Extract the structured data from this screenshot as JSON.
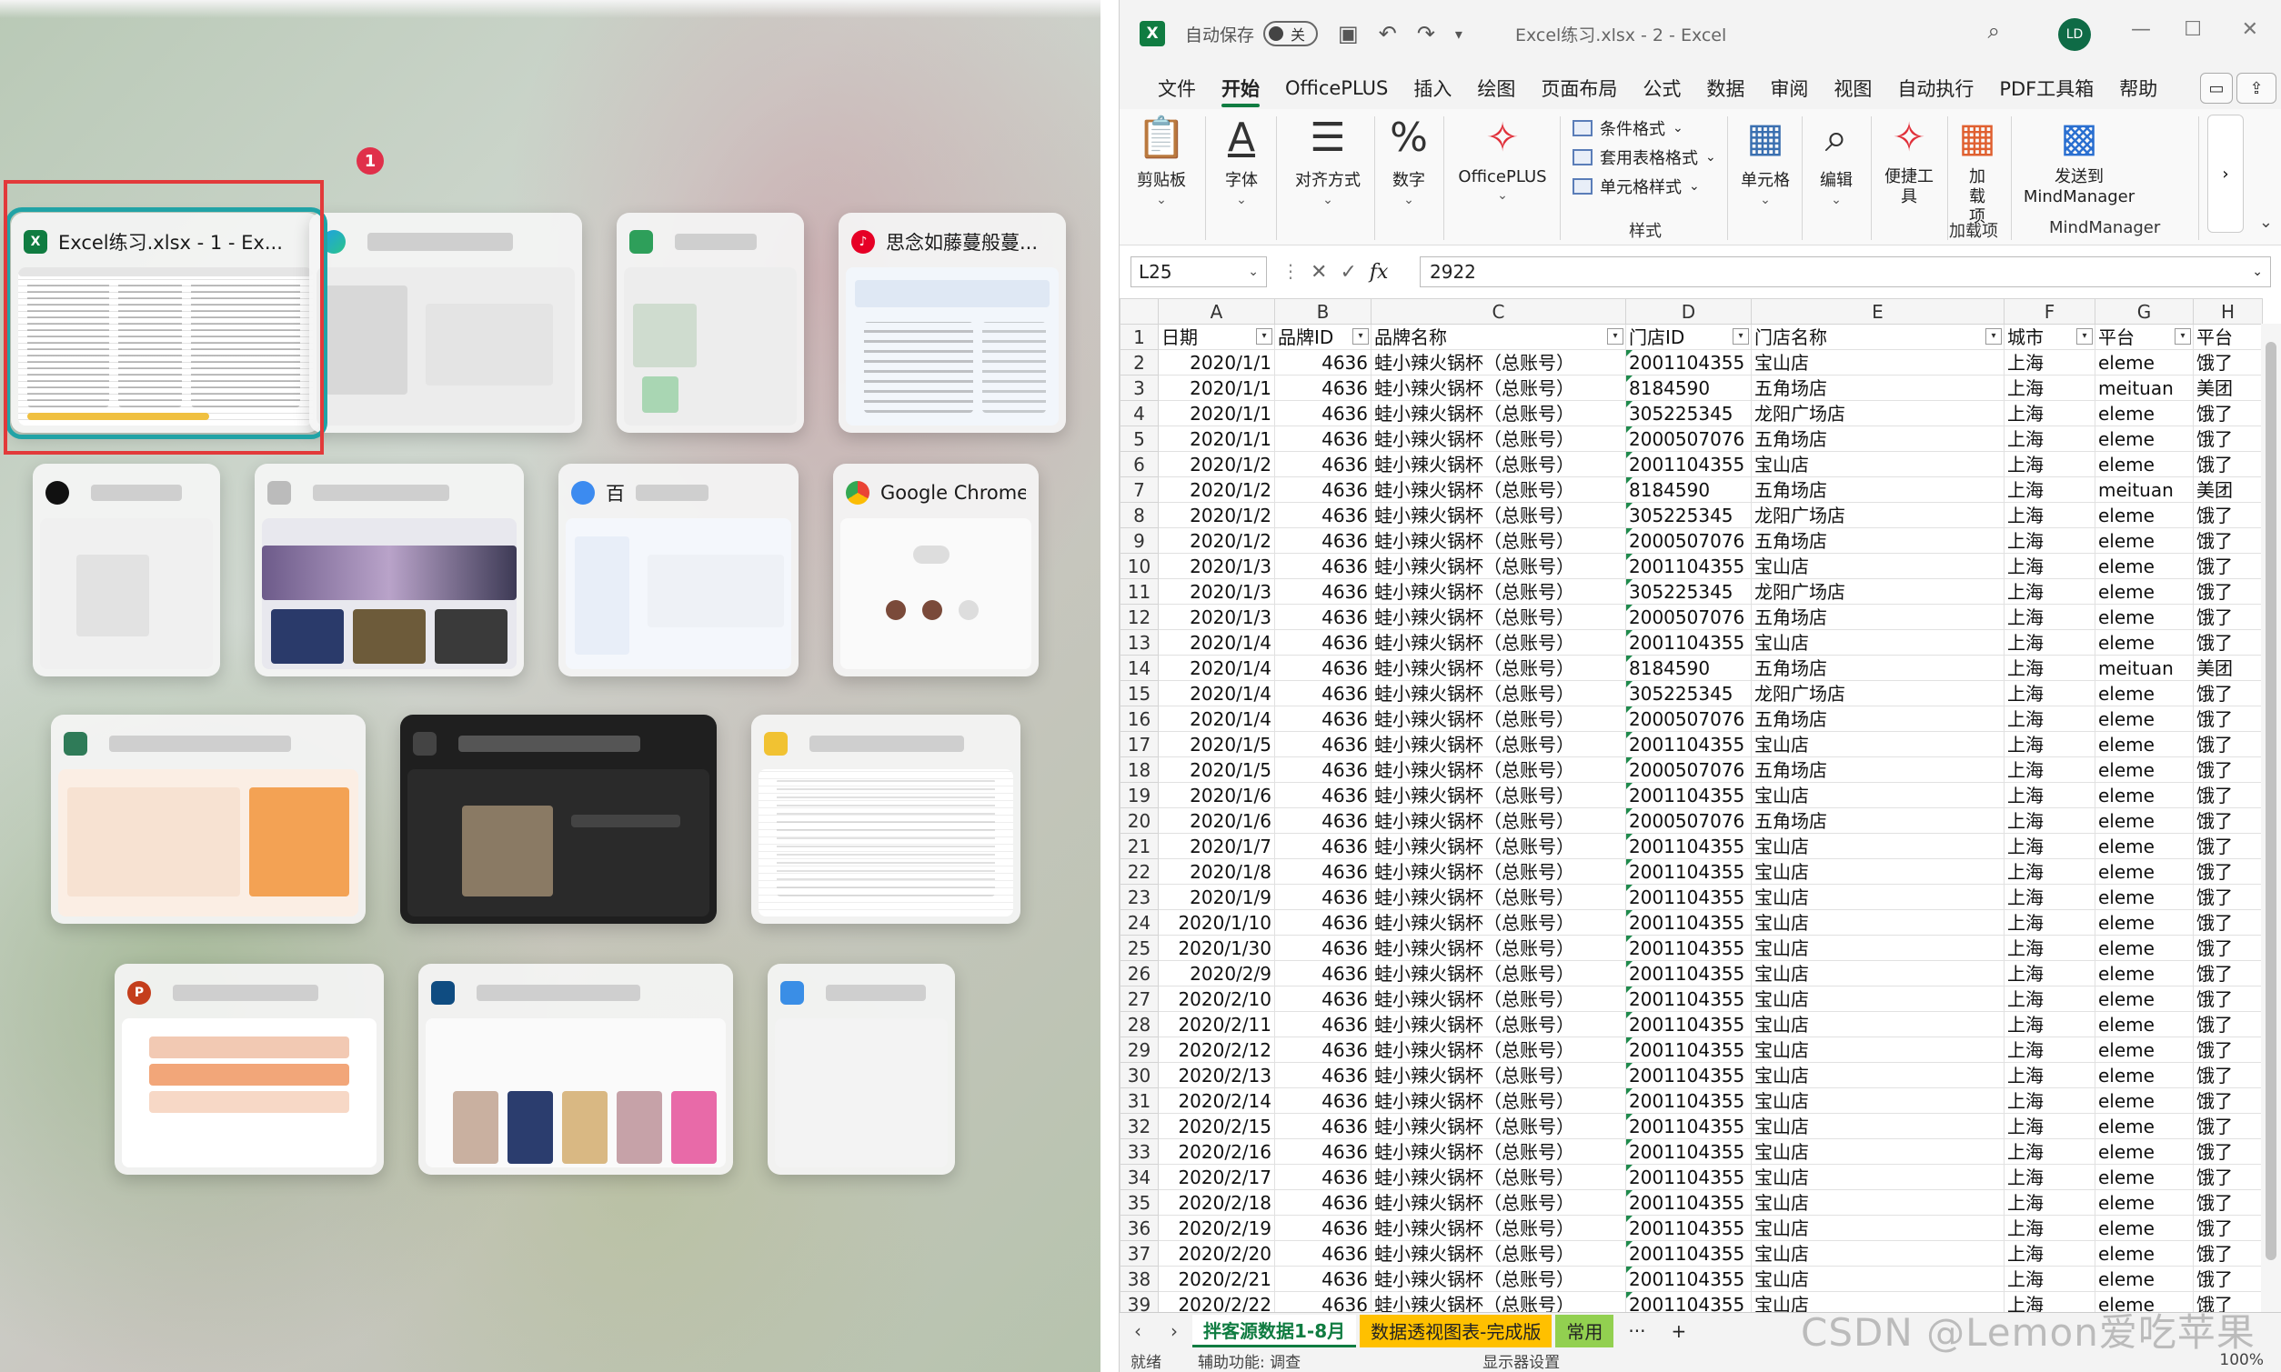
{
  "switcher": {
    "badge_count": "1",
    "windows": [
      {
        "title": "Excel练习.xlsx  -  1 - Ex...",
        "icon": "excel-icon"
      },
      {
        "title": "",
        "icon": "edge-icon"
      },
      {
        "title": "",
        "icon": "app-icon"
      },
      {
        "title": "思念如藤蔓般蔓...",
        "icon": "netease-music-icon"
      },
      {
        "title": "",
        "icon": "qq-icon"
      },
      {
        "title": "",
        "icon": "app-icon"
      },
      {
        "title": "百",
        "icon": "baidu-netdisk-icon"
      },
      {
        "title": "Google Chrome",
        "icon": "chrome-icon"
      },
      {
        "title": "",
        "icon": "app-icon"
      },
      {
        "title": "",
        "icon": "app-icon"
      },
      {
        "title": "",
        "icon": "app-icon"
      },
      {
        "title": "",
        "icon": "powerpoint-icon"
      },
      {
        "title": "",
        "icon": "app-icon"
      },
      {
        "title": "",
        "icon": "app-icon"
      }
    ]
  },
  "excel": {
    "autosave_label": "自动保存",
    "autosave_state": "关",
    "doc_title": "Excel练习.xlsx  -  2  -  Excel",
    "user_initials": "LD",
    "menu": [
      "文件",
      "开始",
      "OfficePLUS",
      "插入",
      "绘图",
      "页面布局",
      "公式",
      "数据",
      "审阅",
      "视图",
      "自动执行",
      "PDF工具箱",
      "帮助"
    ],
    "active_menu": "开始",
    "ribbon": {
      "clipboard": "剪贴板",
      "font": "字体",
      "alignment": "对齐方式",
      "number": "数字",
      "officeplus": "OfficePLUS",
      "conditional_format": "条件格式",
      "table_format": "套用表格格式",
      "cell_style": "单元格样式",
      "styles_group": "样式",
      "cells": "单元格",
      "editing": "编辑",
      "quick_tools": "便捷工具",
      "addins": "加载项",
      "addins_group": "加载项",
      "mindmanager": "发送到MindManager",
      "mindmanager_group": "MindManager"
    },
    "name_box": "L25",
    "formula_value": "2922",
    "columns": [
      "A",
      "B",
      "C",
      "D",
      "E",
      "F",
      "G",
      "H"
    ],
    "headers": [
      "日期",
      "品牌ID",
      "品牌名称",
      "门店ID",
      "门店名称",
      "城市",
      "平台",
      "平台"
    ],
    "rows": [
      [
        "2",
        "2020/1/1",
        "4636",
        "蛙小辣火锅杯（总账号）",
        "2001104355",
        "宝山店",
        "上海",
        "eleme",
        "饿了"
      ],
      [
        "3",
        "2020/1/1",
        "4636",
        "蛙小辣火锅杯（总账号）",
        "8184590",
        "五角场店",
        "上海",
        "meituan",
        "美团"
      ],
      [
        "4",
        "2020/1/1",
        "4636",
        "蛙小辣火锅杯（总账号）",
        "305225345",
        "龙阳广场店",
        "上海",
        "eleme",
        "饿了"
      ],
      [
        "5",
        "2020/1/1",
        "4636",
        "蛙小辣火锅杯（总账号）",
        "2000507076",
        "五角场店",
        "上海",
        "eleme",
        "饿了"
      ],
      [
        "6",
        "2020/1/2",
        "4636",
        "蛙小辣火锅杯（总账号）",
        "2001104355",
        "宝山店",
        "上海",
        "eleme",
        "饿了"
      ],
      [
        "7",
        "2020/1/2",
        "4636",
        "蛙小辣火锅杯（总账号）",
        "8184590",
        "五角场店",
        "上海",
        "meituan",
        "美团"
      ],
      [
        "8",
        "2020/1/2",
        "4636",
        "蛙小辣火锅杯（总账号）",
        "305225345",
        "龙阳广场店",
        "上海",
        "eleme",
        "饿了"
      ],
      [
        "9",
        "2020/1/2",
        "4636",
        "蛙小辣火锅杯（总账号）",
        "2000507076",
        "五角场店",
        "上海",
        "eleme",
        "饿了"
      ],
      [
        "10",
        "2020/1/3",
        "4636",
        "蛙小辣火锅杯（总账号）",
        "2001104355",
        "宝山店",
        "上海",
        "eleme",
        "饿了"
      ],
      [
        "11",
        "2020/1/3",
        "4636",
        "蛙小辣火锅杯（总账号）",
        "305225345",
        "龙阳广场店",
        "上海",
        "eleme",
        "饿了"
      ],
      [
        "12",
        "2020/1/3",
        "4636",
        "蛙小辣火锅杯（总账号）",
        "2000507076",
        "五角场店",
        "上海",
        "eleme",
        "饿了"
      ],
      [
        "13",
        "2020/1/4",
        "4636",
        "蛙小辣火锅杯（总账号）",
        "2001104355",
        "宝山店",
        "上海",
        "eleme",
        "饿了"
      ],
      [
        "14",
        "2020/1/4",
        "4636",
        "蛙小辣火锅杯（总账号）",
        "8184590",
        "五角场店",
        "上海",
        "meituan",
        "美团"
      ],
      [
        "15",
        "2020/1/4",
        "4636",
        "蛙小辣火锅杯（总账号）",
        "305225345",
        "龙阳广场店",
        "上海",
        "eleme",
        "饿了"
      ],
      [
        "16",
        "2020/1/4",
        "4636",
        "蛙小辣火锅杯（总账号）",
        "2000507076",
        "五角场店",
        "上海",
        "eleme",
        "饿了"
      ],
      [
        "17",
        "2020/1/5",
        "4636",
        "蛙小辣火锅杯（总账号）",
        "2001104355",
        "宝山店",
        "上海",
        "eleme",
        "饿了"
      ],
      [
        "18",
        "2020/1/5",
        "4636",
        "蛙小辣火锅杯（总账号）",
        "2000507076",
        "五角场店",
        "上海",
        "eleme",
        "饿了"
      ],
      [
        "19",
        "2020/1/6",
        "4636",
        "蛙小辣火锅杯（总账号）",
        "2001104355",
        "宝山店",
        "上海",
        "eleme",
        "饿了"
      ],
      [
        "20",
        "2020/1/6",
        "4636",
        "蛙小辣火锅杯（总账号）",
        "2000507076",
        "五角场店",
        "上海",
        "eleme",
        "饿了"
      ],
      [
        "21",
        "2020/1/7",
        "4636",
        "蛙小辣火锅杯（总账号）",
        "2001104355",
        "宝山店",
        "上海",
        "eleme",
        "饿了"
      ],
      [
        "22",
        "2020/1/8",
        "4636",
        "蛙小辣火锅杯（总账号）",
        "2001104355",
        "宝山店",
        "上海",
        "eleme",
        "饿了"
      ],
      [
        "23",
        "2020/1/9",
        "4636",
        "蛙小辣火锅杯（总账号）",
        "2001104355",
        "宝山店",
        "上海",
        "eleme",
        "饿了"
      ],
      [
        "24",
        "2020/1/10",
        "4636",
        "蛙小辣火锅杯（总账号）",
        "2001104355",
        "宝山店",
        "上海",
        "eleme",
        "饿了"
      ],
      [
        "25",
        "2020/1/30",
        "4636",
        "蛙小辣火锅杯（总账号）",
        "2001104355",
        "宝山店",
        "上海",
        "eleme",
        "饿了"
      ],
      [
        "26",
        "2020/2/9",
        "4636",
        "蛙小辣火锅杯（总账号）",
        "2001104355",
        "宝山店",
        "上海",
        "eleme",
        "饿了"
      ],
      [
        "27",
        "2020/2/10",
        "4636",
        "蛙小辣火锅杯（总账号）",
        "2001104355",
        "宝山店",
        "上海",
        "eleme",
        "饿了"
      ],
      [
        "28",
        "2020/2/11",
        "4636",
        "蛙小辣火锅杯（总账号）",
        "2001104355",
        "宝山店",
        "上海",
        "eleme",
        "饿了"
      ],
      [
        "29",
        "2020/2/12",
        "4636",
        "蛙小辣火锅杯（总账号）",
        "2001104355",
        "宝山店",
        "上海",
        "eleme",
        "饿了"
      ],
      [
        "30",
        "2020/2/13",
        "4636",
        "蛙小辣火锅杯（总账号）",
        "2001104355",
        "宝山店",
        "上海",
        "eleme",
        "饿了"
      ],
      [
        "31",
        "2020/2/14",
        "4636",
        "蛙小辣火锅杯（总账号）",
        "2001104355",
        "宝山店",
        "上海",
        "eleme",
        "饿了"
      ],
      [
        "32",
        "2020/2/15",
        "4636",
        "蛙小辣火锅杯（总账号）",
        "2001104355",
        "宝山店",
        "上海",
        "eleme",
        "饿了"
      ],
      [
        "33",
        "2020/2/16",
        "4636",
        "蛙小辣火锅杯（总账号）",
        "2001104355",
        "宝山店",
        "上海",
        "eleme",
        "饿了"
      ],
      [
        "34",
        "2020/2/17",
        "4636",
        "蛙小辣火锅杯（总账号）",
        "2001104355",
        "宝山店",
        "上海",
        "eleme",
        "饿了"
      ],
      [
        "35",
        "2020/2/18",
        "4636",
        "蛙小辣火锅杯（总账号）",
        "2001104355",
        "宝山店",
        "上海",
        "eleme",
        "饿了"
      ],
      [
        "36",
        "2020/2/19",
        "4636",
        "蛙小辣火锅杯（总账号）",
        "2001104355",
        "宝山店",
        "上海",
        "eleme",
        "饿了"
      ],
      [
        "37",
        "2020/2/20",
        "4636",
        "蛙小辣火锅杯（总账号）",
        "2001104355",
        "宝山店",
        "上海",
        "eleme",
        "饿了"
      ],
      [
        "38",
        "2020/2/21",
        "4636",
        "蛙小辣火锅杯（总账号）",
        "2001104355",
        "宝山店",
        "上海",
        "eleme",
        "饿了"
      ],
      [
        "39",
        "2020/2/22",
        "4636",
        "蛙小辣火锅杯（总账号）",
        "2001104355",
        "宝山店",
        "上海",
        "eleme",
        "饿了"
      ]
    ],
    "sheet_tabs": [
      "拌客源数据1-8月",
      "数据透视图表-完成版",
      "常用"
    ],
    "more_tabs": "···",
    "add_sheet": "+",
    "status": [
      "就绪",
      "辅助功能: 调查",
      "显示器设置",
      "100%"
    ]
  },
  "watermark": "CSDN @Lemon爱吃苹果"
}
